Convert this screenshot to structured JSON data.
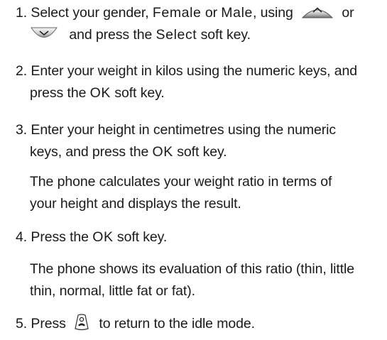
{
  "steps": [
    {
      "number": "1.",
      "text_a": "Select your gender,",
      "opt_female": "Female",
      "or_1": "or",
      "opt_male": "Male",
      "text_b": ", using",
      "or_2": "or",
      "text_c": "and press the",
      "select_key": "Select",
      "text_d": "soft key.",
      "icons": [
        "up-key-icon",
        "down-key-icon"
      ]
    },
    {
      "number": "2.",
      "line1": "Enter your weight in kilos using the numeric keys, and",
      "line2_a": "press the",
      "ok_key": "OK",
      "line2_b": "soft key."
    },
    {
      "number": "3.",
      "line1": "Enter your height in centimetres using the numeric",
      "line2_a": "keys, and press the",
      "ok_key": "OK",
      "line2_b": "soft key."
    },
    {
      "number": "4.",
      "line1_a": "Press the",
      "ok_key": "OK",
      "line1_b": "soft key."
    },
    {
      "number": "5.",
      "text_a": "Press",
      "text_b": "to return to the idle mode.",
      "icons": [
        "end-key-icon"
      ]
    }
  ],
  "notes": [
    {
      "line1": "The phone calculates your weight ratio in terms of",
      "line2": "your height and displays the result."
    },
    {
      "line1": "The phone shows its evaluation of this ratio (thin, little",
      "line2": "thin, normal, little fat or fat)."
    }
  ]
}
